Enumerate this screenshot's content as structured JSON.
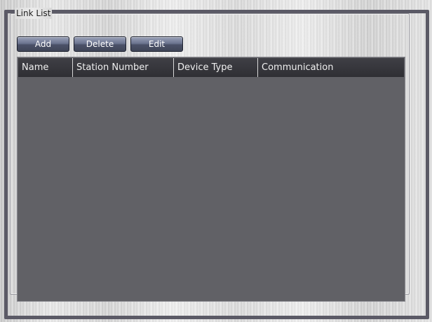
{
  "groupbox": {
    "title": "Link List"
  },
  "toolbar": {
    "add_label": "Add",
    "delete_label": "Delete",
    "edit_label": "Edit"
  },
  "table": {
    "columns": [
      {
        "label": "Name"
      },
      {
        "label": "Station Number"
      },
      {
        "label": "Device Type"
      },
      {
        "label": "Communication"
      }
    ],
    "rows": []
  },
  "colors": {
    "frame": "#5b5a66",
    "table_background": "#616166",
    "header_background": "#3f3f45",
    "button_gradient_top": "#9aa2b8",
    "button_gradient_bottom": "#404658"
  }
}
